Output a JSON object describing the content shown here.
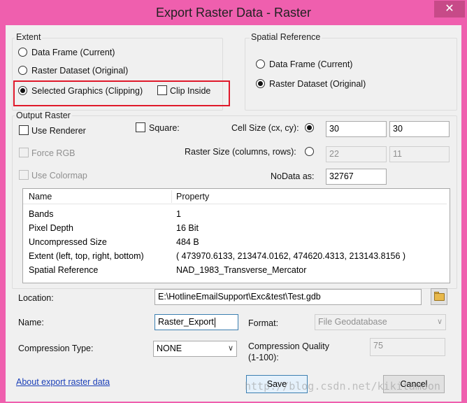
{
  "window": {
    "title": "Export Raster Data - Raster",
    "close_glyph": "✕"
  },
  "extent": {
    "label": "Extent",
    "options": [
      {
        "label": "Data Frame (Current)",
        "selected": false
      },
      {
        "label": "Raster Dataset (Original)",
        "selected": false
      },
      {
        "label": "Selected Graphics (Clipping)",
        "selected": true
      }
    ],
    "clip_inside_label": "Clip Inside",
    "clip_inside_checked": false
  },
  "spatial_reference": {
    "label": "Spatial Reference",
    "options": [
      {
        "label": "Data Frame (Current)",
        "selected": false
      },
      {
        "label": "Raster Dataset (Original)",
        "selected": true
      }
    ]
  },
  "output_raster": {
    "label": "Output Raster",
    "use_renderer_label": "Use Renderer",
    "force_rgb_label": "Force RGB",
    "use_colormap_label": "Use Colormap",
    "square_label": "Square:",
    "cell_size_label": "Cell Size (cx, cy):",
    "cell_size_cx": "30",
    "cell_size_cy": "30",
    "raster_size_label": "Raster Size (columns, rows):",
    "raster_size_columns": "22",
    "raster_size_rows": "11",
    "nodata_label": "NoData as:",
    "nodata_value": "32767"
  },
  "properties": {
    "headers": [
      "Name",
      "Property"
    ],
    "rows": [
      [
        "Bands",
        "1"
      ],
      [
        "Pixel Depth",
        "16 Bit"
      ],
      [
        "Uncompressed Size",
        "484 B"
      ],
      [
        "Extent (left, top, right, bottom)",
        "( 473970.6133, 213474.0162, 474620.4313, 213143.8156 )"
      ],
      [
        "Spatial Reference",
        "NAD_1983_Transverse_Mercator"
      ]
    ]
  },
  "location": {
    "label": "Location:",
    "value": "E:\\HotlineEmailSupport\\Exc&test\\Test.gdb"
  },
  "name": {
    "label": "Name:",
    "value": "Raster_Export"
  },
  "format": {
    "label": "Format:",
    "value": "File Geodatabase"
  },
  "compression": {
    "type_label": "Compression Type:",
    "type_value": "NONE",
    "quality_label_line1": "Compression Quality",
    "quality_label_line2": "(1-100):",
    "quality_value": "75"
  },
  "footer": {
    "about_link": "About export raster data",
    "save_label": "Save",
    "cancel_label": "Cancel",
    "watermark": "http://blog.csdn.net/kikitamoon"
  },
  "colors": {
    "title_bar": "#ef5fae",
    "highlight_box": "#e0192b",
    "link": "#1a3fb8"
  }
}
